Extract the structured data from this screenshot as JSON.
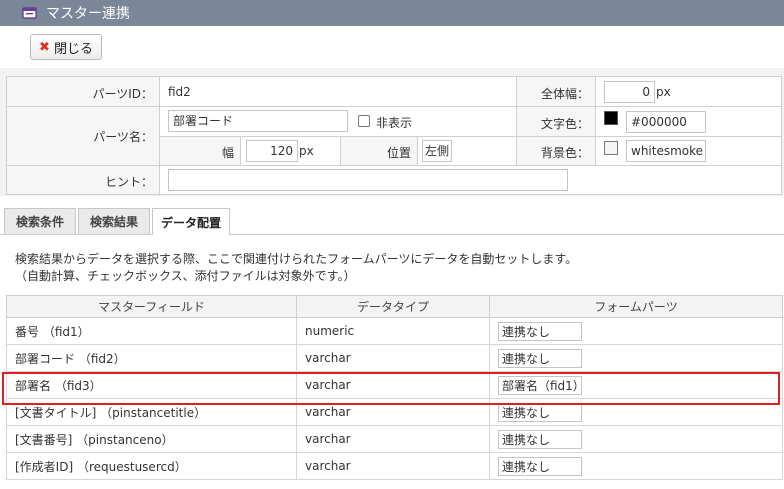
{
  "window": {
    "title": "マスター連携",
    "icon": "window-icon"
  },
  "toolbar": {
    "close_label": "閉じる",
    "close_icon": "close-icon"
  },
  "props": {
    "part_id_label": "パーツID：",
    "part_id_value": "fid2",
    "part_name_label": "パーツ名：",
    "part_name_value": "部署コード",
    "hidden_label": "非表示",
    "width_label": "幅",
    "width_value": "120",
    "width_unit": "px",
    "position_label": "位置",
    "position_value": "左側",
    "hint_label": "ヒント：",
    "hint_value": "",
    "total_width_label": "全体幅：",
    "total_width_value": "0",
    "total_width_unit": "px",
    "text_color_label": "文字色：",
    "text_color_value": "#000000",
    "bg_color_label": "背景色：",
    "bg_color_value": "whitesmoke"
  },
  "tabs": [
    {
      "label": "検索条件",
      "active": false
    },
    {
      "label": "検索結果",
      "active": false
    },
    {
      "label": "データ配置",
      "active": true
    }
  ],
  "description": {
    "line1": "検索結果からデータを選択する際、ここで関連付けられたフォームパーツにデータを自動セットします。",
    "line2": "（自動計算、チェックボックス、添付ファイルは対象外です。）"
  },
  "table": {
    "headers": [
      "マスターフィールド",
      "データタイプ",
      "フォームパーツ"
    ],
    "rows": [
      {
        "field": "番号 （fid1）",
        "type": "numeric",
        "part": "連携なし"
      },
      {
        "field": "部署コード （fid2）",
        "type": "varchar",
        "part": "連携なし"
      },
      {
        "field": "部署名 （fid3）",
        "type": "varchar",
        "part": "部署名（fid1）"
      },
      {
        "field": "[文書タイトル] （pinstancetitle）",
        "type": "varchar",
        "part": "連携なし"
      },
      {
        "field": "[文書番号] （pinstanceno）",
        "type": "varchar",
        "part": "連携なし"
      },
      {
        "field": "[作成者ID] （requestusercd）",
        "type": "varchar",
        "part": "連携なし"
      }
    ]
  },
  "colors": {
    "titlebar": "#7a8799",
    "highlight": "#e02020",
    "close_x": "#e0301e"
  }
}
